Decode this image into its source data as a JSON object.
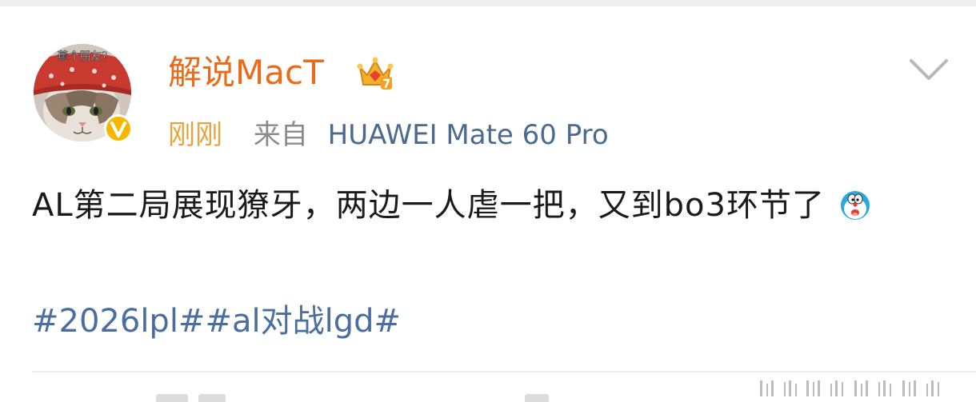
{
  "post": {
    "author": {
      "name": "解说MacT",
      "avatar_caption": "蕉个朋友?",
      "verified_icon": "verified-v-badge",
      "membership_icon": "crown-icon"
    },
    "meta": {
      "time": "刚刚",
      "from_label": "来自",
      "device": "HUAWEI Mate 60 Pro"
    },
    "text": "AL第二局展现獠牙，两边一人虐一把，又到bo3环节了",
    "emoji": "doraemon-emoji",
    "hashtags": [
      "#2026lpl#",
      "#al对战lgd#"
    ],
    "more_icon": "chevron-down-icon"
  },
  "colors": {
    "username": "#e86c1a",
    "time": "#e8a33a",
    "meta": "#8a8a8a",
    "device": "#4a6a8e",
    "hashtag": "#4a6ea0",
    "text": "#1a1a1a",
    "badge": "#f5b700"
  }
}
